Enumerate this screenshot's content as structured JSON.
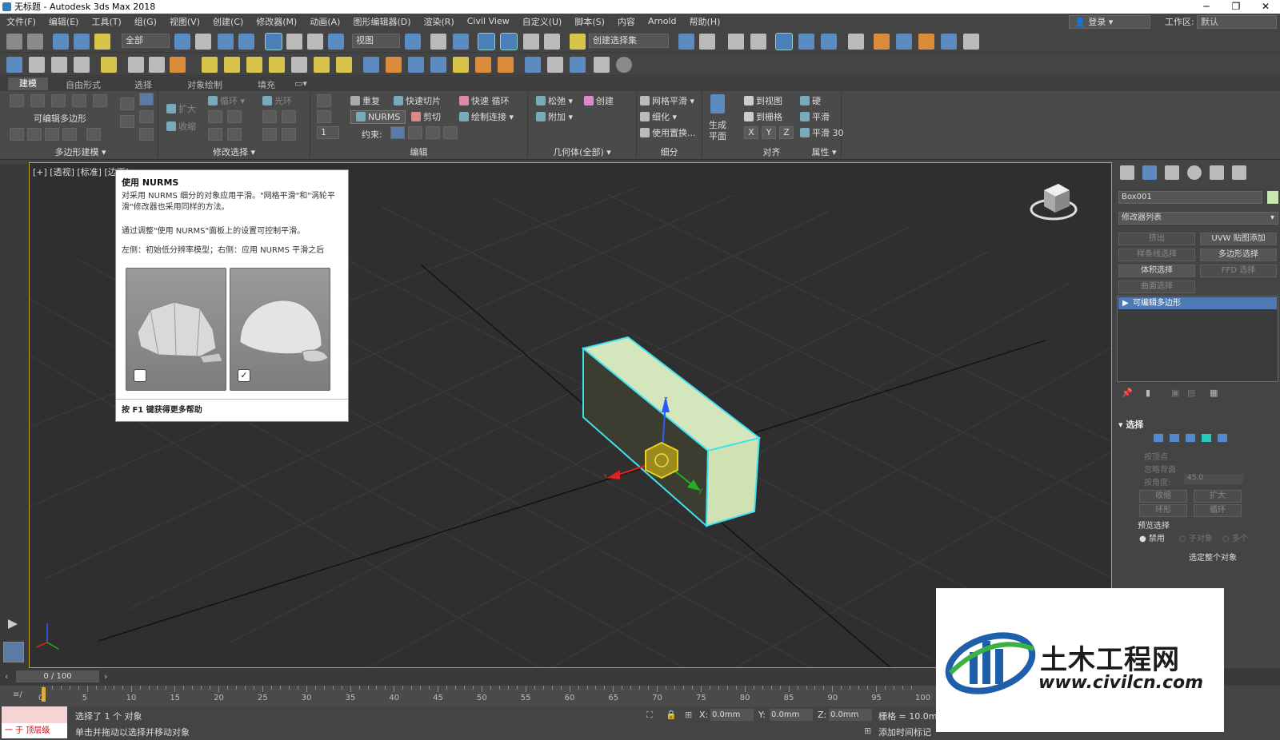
{
  "window": {
    "title": "无标题 - Autodesk 3ds Max 2018"
  },
  "menu": [
    "文件(F)",
    "编辑(E)",
    "工具(T)",
    "组(G)",
    "视图(V)",
    "创建(C)",
    "修改器(M)",
    "动画(A)",
    "图形编辑器(D)",
    "渲染(R)",
    "Civil View",
    "自定义(U)",
    "脚本(S)",
    "内容",
    "Arnold",
    "帮助(H)"
  ],
  "account": {
    "login": "登录",
    "workspace_label": "工作区:",
    "workspace_value": "默认"
  },
  "toolbar": {
    "filter": "全部",
    "ref_coord": "视图",
    "selection_set": "创建选择集"
  },
  "ribbon_tabs": [
    "建模",
    "自由形式",
    "选择",
    "对象绘制",
    "填充"
  ],
  "ribbon": {
    "editpoly_label": "可编辑多边形",
    "group_polymodel": "多边形建模",
    "group_modsel": "修改选择",
    "group_edit": "编辑",
    "group_geometry": "几何体(全部)",
    "group_subdiv": "细分",
    "group_align": "对齐",
    "group_props": "属性",
    "grow": "扩大",
    "shrink": "收缩",
    "loop": "循环",
    "ring": "光环",
    "repeat": "重复",
    "quickslice": "快速切片",
    "quickloop": "快速 循环",
    "nurms": "NURMS",
    "cut": "剪切",
    "paintconnect": "绘制连接",
    "constraint": "约束:",
    "relax": "松弛",
    "create": "创建",
    "attach": "附加",
    "meshsmooth": "网格平滑",
    "tessellate": "细化",
    "usedisplace": "使用置换...",
    "genplane": "生成",
    "genplane2": "平面",
    "toview": "到视图",
    "togrid": "到栅格",
    "hard": "硬",
    "smooth": "平滑",
    "smooth30": "平滑 30",
    "spin": "1"
  },
  "viewport": {
    "label": "[+] [透视] [标准] [边面]"
  },
  "tooltip": {
    "title": "使用 NURMS",
    "line1": "对采用 NURMS 细分的对象应用平滑。\"网格平滑\"和\"涡轮平",
    "line2": "滑\"修改器也采用同样的方法。",
    "line3": "通过调整\"使用 NURMS\"面板上的设置可控制平滑。",
    "line4": "左侧：初始低分辨率模型；右侧：应用 NURMS 平滑之后",
    "help": "按 F1 键获得更多帮助"
  },
  "command_panel": {
    "object_name": "Box001",
    "modifier_list": "修改器列表",
    "buttons": [
      "挤出",
      "UVW 贴图添加",
      "样条线选择",
      "多边形选择",
      "体积选择",
      "FFD 选择",
      "曲面选择"
    ],
    "stack_item": "可编辑多边形",
    "rollout_title": "选择",
    "by_vertex": "按顶点",
    "ignore_back": "忽略背面",
    "by_angle": "按角度:",
    "angle_val": "45.0",
    "shrink": "收缩",
    "grow": "扩大",
    "ring": "环形",
    "loop": "循环",
    "preview": "预览选择",
    "disable": "禁用",
    "subobj": "子对象",
    "multi": "多个",
    "whole": "选定整个对象"
  },
  "timeline": {
    "frame": "0 / 100",
    "ticks": [
      "0",
      "5",
      "10",
      "15",
      "20",
      "25",
      "30",
      "35",
      "40",
      "45",
      "50",
      "55",
      "60",
      "65",
      "70",
      "75",
      "80",
      "85",
      "90",
      "95",
      "100"
    ]
  },
  "status": {
    "selected": "选择了 1 个 对象",
    "hint": "单击并拖动以选择并移动对象",
    "script": "一 于 顶层级",
    "x_label": "X:",
    "x_val": "0.0mm",
    "y_label": "Y:",
    "y_val": "0.0mm",
    "z_label": "Z:",
    "z_val": "0.0mm",
    "grid": "栅格 = 10.0mm",
    "add_time": "添加时间标记"
  },
  "watermark": {
    "cn": "土木工程网",
    "url": "www.civilcn.com"
  },
  "colors": {
    "selected_outline": "#40e0f0",
    "box_fill": "#d4e6bc",
    "viewport_bg": "#2f2f2f",
    "active_border": "#c9a22a"
  }
}
